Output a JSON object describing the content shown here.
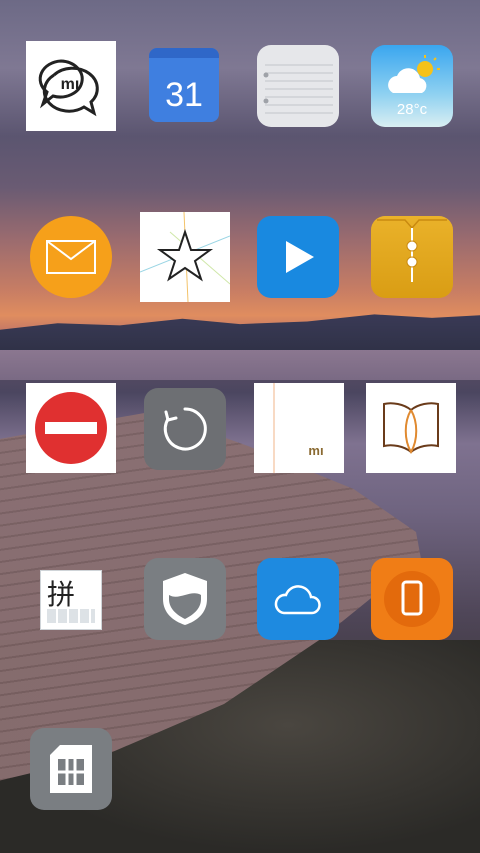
{
  "screen": {
    "type": "android-home-screen"
  },
  "apps": [
    {
      "id": "mi-talk",
      "icon": "mi-chat-icon"
    },
    {
      "id": "calendar",
      "icon": "calendar-icon",
      "date_text": "31"
    },
    {
      "id": "notes",
      "icon": "notepad-icon"
    },
    {
      "id": "weather",
      "icon": "weather-cloud-sun-icon",
      "temperature": "28°c"
    },
    {
      "id": "mail",
      "icon": "envelope-icon"
    },
    {
      "id": "themes",
      "icon": "star-icon"
    },
    {
      "id": "video",
      "icon": "play-icon"
    },
    {
      "id": "file-manager",
      "icon": "folder-clip-icon"
    },
    {
      "id": "blocklist",
      "icon": "no-entry-icon"
    },
    {
      "id": "backup",
      "icon": "restore-icon"
    },
    {
      "id": "mi-store",
      "icon": "mi-logo-icon"
    },
    {
      "id": "books",
      "icon": "open-book-icon"
    },
    {
      "id": "pinyin-keyboard",
      "icon": "pinyin-keyboard-icon",
      "glyph": "拼"
    },
    {
      "id": "security",
      "icon": "shield-icon"
    },
    {
      "id": "cloud",
      "icon": "cloud-icon"
    },
    {
      "id": "phone-manager",
      "icon": "phone-icon"
    },
    {
      "id": "sim-toolkit",
      "icon": "sim-card-icon"
    }
  ],
  "colors": {
    "calendar": "#3f7fe0",
    "weather": "#6cc1ef",
    "mail": "#f6a01a",
    "video": "#1989e0",
    "folder": "#e0a71a",
    "blocklist_red": "#e03030",
    "gray_app": "#6d6f73",
    "cloud": "#1e8ae0",
    "phone_manager": "#f07d16"
  }
}
